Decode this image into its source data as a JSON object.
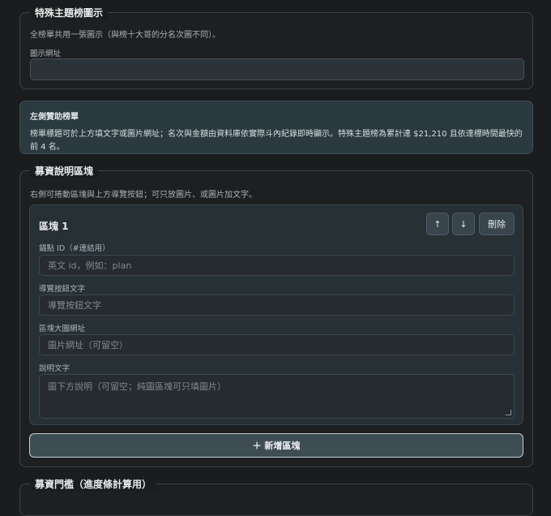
{
  "section_icon": {
    "legend": "特殊主題榜圖示",
    "description": "全榜單共用一張圖示（與榜十大哥的分名次圖不同）。",
    "url_label": "圖示網址",
    "url_value": ""
  },
  "notice": {
    "title": "左側贊助榜單",
    "body": "榜單標題可於上方填文字或圖片網址；名次與金額由資料庫依實際斗內紀錄即時顯示。特殊主題榜為累計達 $21,210 且依達標時間最快的前 4 名。"
  },
  "section_blocks": {
    "legend": "募資說明區塊",
    "description": "右側可捲動區塊與上方導覽按鈕；可只放圖片、或圖片加文字。",
    "block": {
      "title": "區塊 1",
      "up_label": "↑",
      "down_label": "↓",
      "delete_label": "刪除",
      "anchor_label": "錨點 ID（#連結用）",
      "anchor_placeholder": "英文 id，例如：plan",
      "nav_label": "導覽按鈕文字",
      "nav_placeholder": "導覽按鈕文字",
      "image_label": "區塊大圖網址",
      "image_placeholder": "圖片網址（可留空）",
      "caption_label": "說明文字",
      "caption_placeholder": "圖下方說明（可留空；純圖區塊可只填圖片）"
    },
    "add_label": "＋ 新增區塊"
  },
  "next_section": {
    "legend": "募資門檻（進度條計算用）"
  }
}
